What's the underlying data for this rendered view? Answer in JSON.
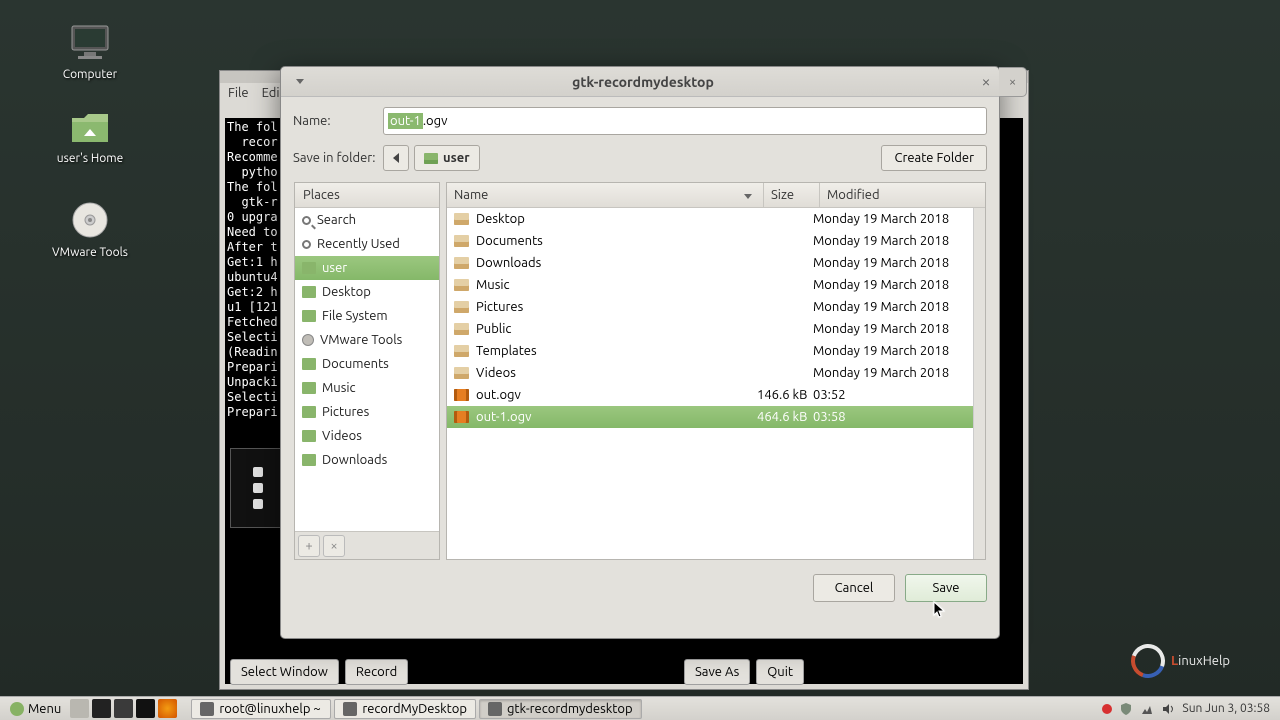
{
  "desktop": {
    "icons": [
      {
        "label": "Computer"
      },
      {
        "label": "user's Home"
      },
      {
        "label": "VMware Tools"
      }
    ]
  },
  "terminal": {
    "menu_file": "File",
    "menu_edit": "Edit",
    "content": "The fol\n  recor\nRecomme\n  pytho\nThe fol\n  gtk-r\n0 upgra\nNeed to\nAfter t\nGet:1 h\nubuntu4\nGet:2 h\nu1 [121\nFetched\nSelecti\n(Readin\nPrepari\nUnpacki\nSelecti\nPrepari"
  },
  "rmd_controls": {
    "select_window": "Select Window",
    "record": "Record",
    "save_as": "Save As",
    "quit": "Quit"
  },
  "dialog": {
    "title": "gtk-recordmydesktop",
    "name_label": "Name:",
    "name_selected": "out-1",
    "name_rest": ".ogv",
    "saveinfolder_label": "Save in folder:",
    "current_folder": "user",
    "create_folder": "Create Folder",
    "places_header": "Places",
    "places": [
      {
        "label": "Search",
        "icon": "search"
      },
      {
        "label": "Recently Used",
        "icon": "clock"
      },
      {
        "label": "user",
        "icon": "folder",
        "selected": true
      },
      {
        "label": "Desktop",
        "icon": "folder"
      },
      {
        "label": "File System",
        "icon": "folder"
      },
      {
        "label": "VMware Tools",
        "icon": "disk"
      },
      {
        "label": "Documents",
        "icon": "folder"
      },
      {
        "label": "Music",
        "icon": "folder"
      },
      {
        "label": "Pictures",
        "icon": "folder"
      },
      {
        "label": "Videos",
        "icon": "folder"
      },
      {
        "label": "Downloads",
        "icon": "folder"
      }
    ],
    "col_name": "Name",
    "col_size": "Size",
    "col_modified": "Modified",
    "files": [
      {
        "name": "Desktop",
        "type": "folder",
        "size": "",
        "modified": "Monday 19 March 2018"
      },
      {
        "name": "Documents",
        "type": "folder",
        "size": "",
        "modified": "Monday 19 March 2018"
      },
      {
        "name": "Downloads",
        "type": "folder",
        "size": "",
        "modified": "Monday 19 March 2018"
      },
      {
        "name": "Music",
        "type": "folder",
        "size": "",
        "modified": "Monday 19 March 2018"
      },
      {
        "name": "Pictures",
        "type": "folder",
        "size": "",
        "modified": "Monday 19 March 2018"
      },
      {
        "name": "Public",
        "type": "folder",
        "size": "",
        "modified": "Monday 19 March 2018"
      },
      {
        "name": "Templates",
        "type": "folder",
        "size": "",
        "modified": "Monday 19 March 2018"
      },
      {
        "name": "Videos",
        "type": "folder",
        "size": "",
        "modified": "Monday 19 March 2018"
      },
      {
        "name": "out.ogv",
        "type": "video",
        "size": "146.6 kB",
        "modified": "03:52"
      },
      {
        "name": "out-1.ogv",
        "type": "video",
        "size": "464.6 kB",
        "modified": "03:58",
        "selected": true
      }
    ],
    "cancel": "Cancel",
    "save": "Save"
  },
  "taskbar": {
    "menu": "Menu",
    "tasks": [
      {
        "label": "root@linuxhelp ~"
      },
      {
        "label": "recordMyDesktop"
      },
      {
        "label": "gtk-recordmydesktop",
        "active": true
      }
    ],
    "clock": "Sun Jun  3, 03:58"
  },
  "watermark": {
    "l": "L",
    "rest": "inuxHelp"
  }
}
